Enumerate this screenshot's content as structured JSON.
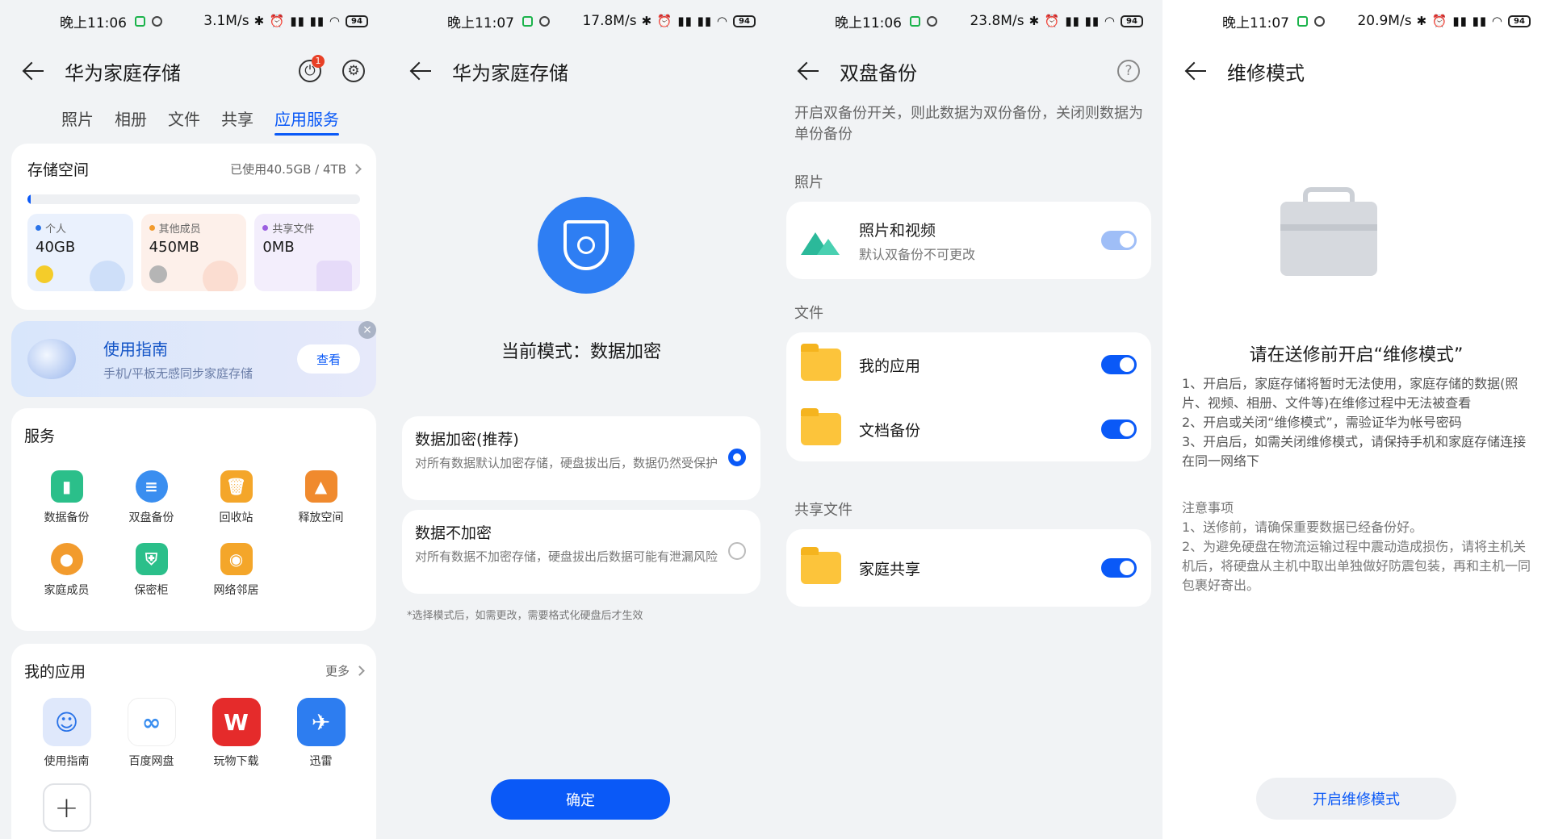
{
  "screens": [
    {
      "status": {
        "time": "晚上11:06",
        "speed": "3.1M/s",
        "battery": "94"
      },
      "header": {
        "title": "华为家庭存储",
        "badge": "1"
      },
      "tabs": [
        "照片",
        "相册",
        "文件",
        "共享",
        "应用服务"
      ],
      "active_tab": "应用服务",
      "storage": {
        "title": "存储空间",
        "used": "已使用40.5GB / 4TB",
        "used_fraction": 0.01,
        "tiles": [
          {
            "label": "个人",
            "value": "40GB",
            "color": "#2b74e8"
          },
          {
            "label": "其他成员",
            "value": "450MB",
            "color": "#f29b2d"
          },
          {
            "label": "共享文件",
            "value": "0MB",
            "color": "#9b5fe0"
          }
        ]
      },
      "guide": {
        "title": "使用指南",
        "subtitle": "手机/平板无感同步家庭存储",
        "button": "查看"
      },
      "services": {
        "title": "服务",
        "items": [
          {
            "label": "数据备份",
            "icon": "data-backup-icon",
            "color": "#2bbf8a"
          },
          {
            "label": "双盘备份",
            "icon": "dual-disk-icon",
            "color": "#3a8ef0"
          },
          {
            "label": "回收站",
            "icon": "recycle-bin-icon",
            "color": "#f4a62a"
          },
          {
            "label": "释放空间",
            "icon": "broom-icon",
            "color": "#f08a2e"
          },
          {
            "label": "家庭成员",
            "icon": "family-member-icon",
            "color": "#f29b2d"
          },
          {
            "label": "保密柜",
            "icon": "safe-box-icon",
            "color": "#2bbf8a"
          },
          {
            "label": "网络邻居",
            "icon": "network-folder-icon",
            "color": "#f4a62a"
          }
        ]
      },
      "apps": {
        "title": "我的应用",
        "more": "更多",
        "items": [
          {
            "label": "使用指南",
            "icon": "guide-app-icon",
            "color": "#c9d9fb"
          },
          {
            "label": "百度网盘",
            "icon": "baidu-netdisk-icon",
            "color": "#ffffff"
          },
          {
            "label": "玩物下载",
            "icon": "wanwu-download-icon",
            "color": "#e52b2b"
          },
          {
            "label": "迅雷",
            "icon": "xunlei-icon",
            "color": "#2d7df0"
          }
        ]
      }
    },
    {
      "status": {
        "time": "晚上11:07",
        "speed": "17.8M/s",
        "battery": "94"
      },
      "header": {
        "title": "华为家庭存储"
      },
      "mode_text": "当前模式：数据加密",
      "options": [
        {
          "title": "数据加密(推荐)",
          "desc": "对所有数据默认加密存储，硬盘拔出后，数据仍然受保护",
          "selected": true
        },
        {
          "title": "数据不加密",
          "desc": "对所有数据不加密存储，硬盘拔出后数据可能有泄漏风险",
          "selected": false
        }
      ],
      "note": "*选择模式后，如需更改，需要格式化硬盘后才生效",
      "confirm": "确定"
    },
    {
      "status": {
        "time": "晚上11:06",
        "speed": "23.8M/s",
        "battery": "94"
      },
      "header": {
        "title": "双盘备份"
      },
      "description": "开启双备份开关，则此数据为双份备份，关闭则数据为单份备份",
      "sections": [
        {
          "title": "照片",
          "items": [
            {
              "label": "照片和视频",
              "sub": "默认双备份不可更改",
              "on": true,
              "disabled": true
            }
          ]
        },
        {
          "title": "文件",
          "items": [
            {
              "label": "我的应用",
              "on": true
            },
            {
              "label": "文档备份",
              "on": true
            }
          ]
        },
        {
          "title": "共享文件",
          "items": [
            {
              "label": "家庭共享",
              "on": true
            }
          ]
        }
      ]
    },
    {
      "status": {
        "time": "晚上11:07",
        "speed": "20.9M/s",
        "battery": "94"
      },
      "header": {
        "title": "维修模式"
      },
      "heading": "请在送修前开启“维修模式”",
      "steps": [
        "1、开启后，家庭存储将暂时无法使用，家庭存储的数据(照片、视频、相册、文件等)在维修过程中无法被查看",
        "2、开启或关闭“维修模式”，需验证华为帐号密码",
        "3、开启后，如需关闭维修模式，请保持手机和家庭存储连接在同一网络下"
      ],
      "notes_title": "注意事项",
      "notes": [
        "1、送修前，请确保重要数据已经备份好。",
        "2、为避免硬盘在物流运输过程中震动造成损伤，请将主机关机后，将硬盘从主机中取出单独做好防震包装，再和主机一同包裹好寄出。"
      ],
      "button": "开启维修模式"
    }
  ]
}
